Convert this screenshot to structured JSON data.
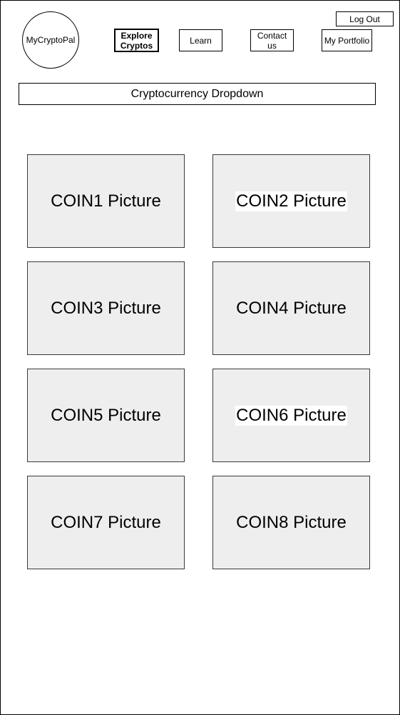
{
  "header": {
    "logo_text": "MyCryptoPal",
    "nav": {
      "explore_line1": "Explore",
      "explore_line2": "Cryptos",
      "learn": "Learn",
      "contact": "Contact us",
      "portfolio": "My Portfolio"
    },
    "logout_label": "Log Out"
  },
  "dropdown": {
    "label": "Cryptocurrency Dropdown"
  },
  "coins": [
    {
      "label": "COIN1 Picture"
    },
    {
      "label": "COIN2 Picture"
    },
    {
      "label": "COIN3 Picture"
    },
    {
      "label": "COIN4 Picture"
    },
    {
      "label": "COIN5 Picture"
    },
    {
      "label": "COIN6 Picture"
    },
    {
      "label": "COIN7 Picture"
    },
    {
      "label": "COIN8 Picture"
    }
  ],
  "colors": {
    "tile_fill": "#eeeeee",
    "tile_border": "#36393d",
    "outline": "#000000",
    "background": "#ffffff"
  }
}
